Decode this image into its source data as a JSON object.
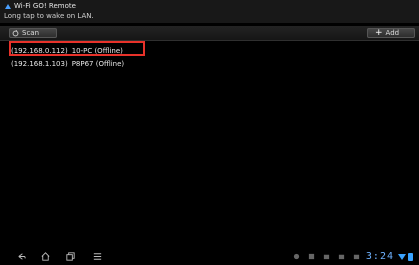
{
  "app": {
    "title": "Wi-Fi GO! Remote",
    "hint": "Long tap to wake on LAN."
  },
  "toolbar": {
    "scan_label": "Scan",
    "add_label": "Add",
    "add_glyph": "+"
  },
  "devices": [
    {
      "ip": "(192.168.0.112)",
      "name": "10-PC (Offline)"
    },
    {
      "ip": "(192.168.1.103)",
      "name": "P8P67 (Offline)"
    }
  ],
  "statusbar": {
    "time": "3:24"
  },
  "colors": {
    "highlight": "#e8322a",
    "clock": "#6fb2ff",
    "background": "#000000"
  },
  "icons": [
    "wifi-go-app-icon",
    "scan-icon",
    "plus-icon",
    "back-icon",
    "home-icon",
    "recent-apps-icon",
    "menu-icon",
    "wifi-icon",
    "battery-icon"
  ]
}
